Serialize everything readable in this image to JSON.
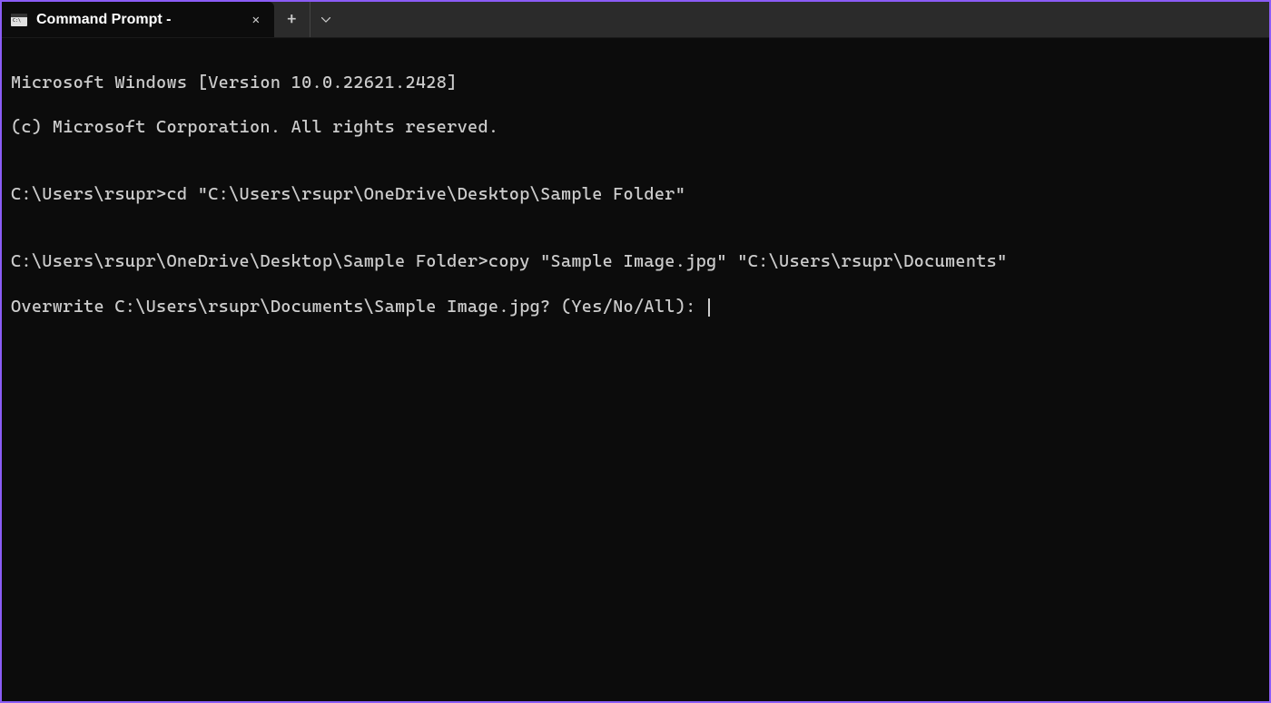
{
  "titleBar": {
    "tab": {
      "title": "Command Prompt -"
    }
  },
  "terminal": {
    "line1": "Microsoft Windows [Version 10.0.22621.2428]",
    "line2": "(c) Microsoft Corporation. All rights reserved.",
    "blank1": "",
    "line3": "C:\\Users\\rsupr>cd \"C:\\Users\\rsupr\\OneDrive\\Desktop\\Sample Folder\"",
    "blank2": "",
    "line4": "C:\\Users\\rsupr\\OneDrive\\Desktop\\Sample Folder>copy \"Sample Image.jpg\" \"C:\\Users\\rsupr\\Documents\"",
    "line5": "Overwrite C:\\Users\\rsupr\\Documents\\Sample Image.jpg? (Yes/No/All): "
  }
}
